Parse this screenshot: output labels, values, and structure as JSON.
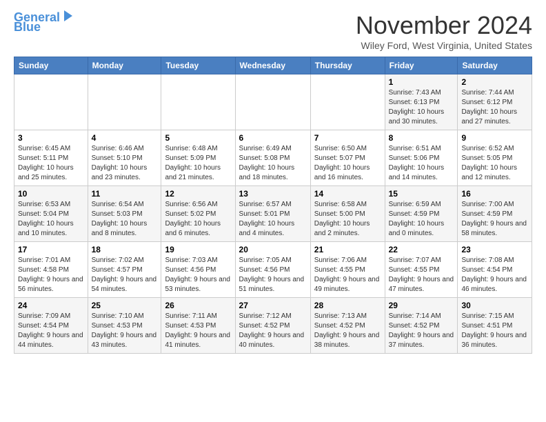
{
  "header": {
    "logo_line1": "General",
    "logo_line2": "Blue",
    "title": "November 2024",
    "location": "Wiley Ford, West Virginia, United States"
  },
  "weekdays": [
    "Sunday",
    "Monday",
    "Tuesday",
    "Wednesday",
    "Thursday",
    "Friday",
    "Saturday"
  ],
  "weeks": [
    [
      {
        "day": "",
        "sunrise": "",
        "sunset": "",
        "daylight": ""
      },
      {
        "day": "",
        "sunrise": "",
        "sunset": "",
        "daylight": ""
      },
      {
        "day": "",
        "sunrise": "",
        "sunset": "",
        "daylight": ""
      },
      {
        "day": "",
        "sunrise": "",
        "sunset": "",
        "daylight": ""
      },
      {
        "day": "",
        "sunrise": "",
        "sunset": "",
        "daylight": ""
      },
      {
        "day": "1",
        "sunrise": "Sunrise: 7:43 AM",
        "sunset": "Sunset: 6:13 PM",
        "daylight": "Daylight: 10 hours and 30 minutes."
      },
      {
        "day": "2",
        "sunrise": "Sunrise: 7:44 AM",
        "sunset": "Sunset: 6:12 PM",
        "daylight": "Daylight: 10 hours and 27 minutes."
      }
    ],
    [
      {
        "day": "3",
        "sunrise": "Sunrise: 6:45 AM",
        "sunset": "Sunset: 5:11 PM",
        "daylight": "Daylight: 10 hours and 25 minutes."
      },
      {
        "day": "4",
        "sunrise": "Sunrise: 6:46 AM",
        "sunset": "Sunset: 5:10 PM",
        "daylight": "Daylight: 10 hours and 23 minutes."
      },
      {
        "day": "5",
        "sunrise": "Sunrise: 6:48 AM",
        "sunset": "Sunset: 5:09 PM",
        "daylight": "Daylight: 10 hours and 21 minutes."
      },
      {
        "day": "6",
        "sunrise": "Sunrise: 6:49 AM",
        "sunset": "Sunset: 5:08 PM",
        "daylight": "Daylight: 10 hours and 18 minutes."
      },
      {
        "day": "7",
        "sunrise": "Sunrise: 6:50 AM",
        "sunset": "Sunset: 5:07 PM",
        "daylight": "Daylight: 10 hours and 16 minutes."
      },
      {
        "day": "8",
        "sunrise": "Sunrise: 6:51 AM",
        "sunset": "Sunset: 5:06 PM",
        "daylight": "Daylight: 10 hours and 14 minutes."
      },
      {
        "day": "9",
        "sunrise": "Sunrise: 6:52 AM",
        "sunset": "Sunset: 5:05 PM",
        "daylight": "Daylight: 10 hours and 12 minutes."
      }
    ],
    [
      {
        "day": "10",
        "sunrise": "Sunrise: 6:53 AM",
        "sunset": "Sunset: 5:04 PM",
        "daylight": "Daylight: 10 hours and 10 minutes."
      },
      {
        "day": "11",
        "sunrise": "Sunrise: 6:54 AM",
        "sunset": "Sunset: 5:03 PM",
        "daylight": "Daylight: 10 hours and 8 minutes."
      },
      {
        "day": "12",
        "sunrise": "Sunrise: 6:56 AM",
        "sunset": "Sunset: 5:02 PM",
        "daylight": "Daylight: 10 hours and 6 minutes."
      },
      {
        "day": "13",
        "sunrise": "Sunrise: 6:57 AM",
        "sunset": "Sunset: 5:01 PM",
        "daylight": "Daylight: 10 hours and 4 minutes."
      },
      {
        "day": "14",
        "sunrise": "Sunrise: 6:58 AM",
        "sunset": "Sunset: 5:00 PM",
        "daylight": "Daylight: 10 hours and 2 minutes."
      },
      {
        "day": "15",
        "sunrise": "Sunrise: 6:59 AM",
        "sunset": "Sunset: 4:59 PM",
        "daylight": "Daylight: 10 hours and 0 minutes."
      },
      {
        "day": "16",
        "sunrise": "Sunrise: 7:00 AM",
        "sunset": "Sunset: 4:59 PM",
        "daylight": "Daylight: 9 hours and 58 minutes."
      }
    ],
    [
      {
        "day": "17",
        "sunrise": "Sunrise: 7:01 AM",
        "sunset": "Sunset: 4:58 PM",
        "daylight": "Daylight: 9 hours and 56 minutes."
      },
      {
        "day": "18",
        "sunrise": "Sunrise: 7:02 AM",
        "sunset": "Sunset: 4:57 PM",
        "daylight": "Daylight: 9 hours and 54 minutes."
      },
      {
        "day": "19",
        "sunrise": "Sunrise: 7:03 AM",
        "sunset": "Sunset: 4:56 PM",
        "daylight": "Daylight: 9 hours and 53 minutes."
      },
      {
        "day": "20",
        "sunrise": "Sunrise: 7:05 AM",
        "sunset": "Sunset: 4:56 PM",
        "daylight": "Daylight: 9 hours and 51 minutes."
      },
      {
        "day": "21",
        "sunrise": "Sunrise: 7:06 AM",
        "sunset": "Sunset: 4:55 PM",
        "daylight": "Daylight: 9 hours and 49 minutes."
      },
      {
        "day": "22",
        "sunrise": "Sunrise: 7:07 AM",
        "sunset": "Sunset: 4:55 PM",
        "daylight": "Daylight: 9 hours and 47 minutes."
      },
      {
        "day": "23",
        "sunrise": "Sunrise: 7:08 AM",
        "sunset": "Sunset: 4:54 PM",
        "daylight": "Daylight: 9 hours and 46 minutes."
      }
    ],
    [
      {
        "day": "24",
        "sunrise": "Sunrise: 7:09 AM",
        "sunset": "Sunset: 4:54 PM",
        "daylight": "Daylight: 9 hours and 44 minutes."
      },
      {
        "day": "25",
        "sunrise": "Sunrise: 7:10 AM",
        "sunset": "Sunset: 4:53 PM",
        "daylight": "Daylight: 9 hours and 43 minutes."
      },
      {
        "day": "26",
        "sunrise": "Sunrise: 7:11 AM",
        "sunset": "Sunset: 4:53 PM",
        "daylight": "Daylight: 9 hours and 41 minutes."
      },
      {
        "day": "27",
        "sunrise": "Sunrise: 7:12 AM",
        "sunset": "Sunset: 4:52 PM",
        "daylight": "Daylight: 9 hours and 40 minutes."
      },
      {
        "day": "28",
        "sunrise": "Sunrise: 7:13 AM",
        "sunset": "Sunset: 4:52 PM",
        "daylight": "Daylight: 9 hours and 38 minutes."
      },
      {
        "day": "29",
        "sunrise": "Sunrise: 7:14 AM",
        "sunset": "Sunset: 4:52 PM",
        "daylight": "Daylight: 9 hours and 37 minutes."
      },
      {
        "day": "30",
        "sunrise": "Sunrise: 7:15 AM",
        "sunset": "Sunset: 4:51 PM",
        "daylight": "Daylight: 9 hours and 36 minutes."
      }
    ]
  ]
}
